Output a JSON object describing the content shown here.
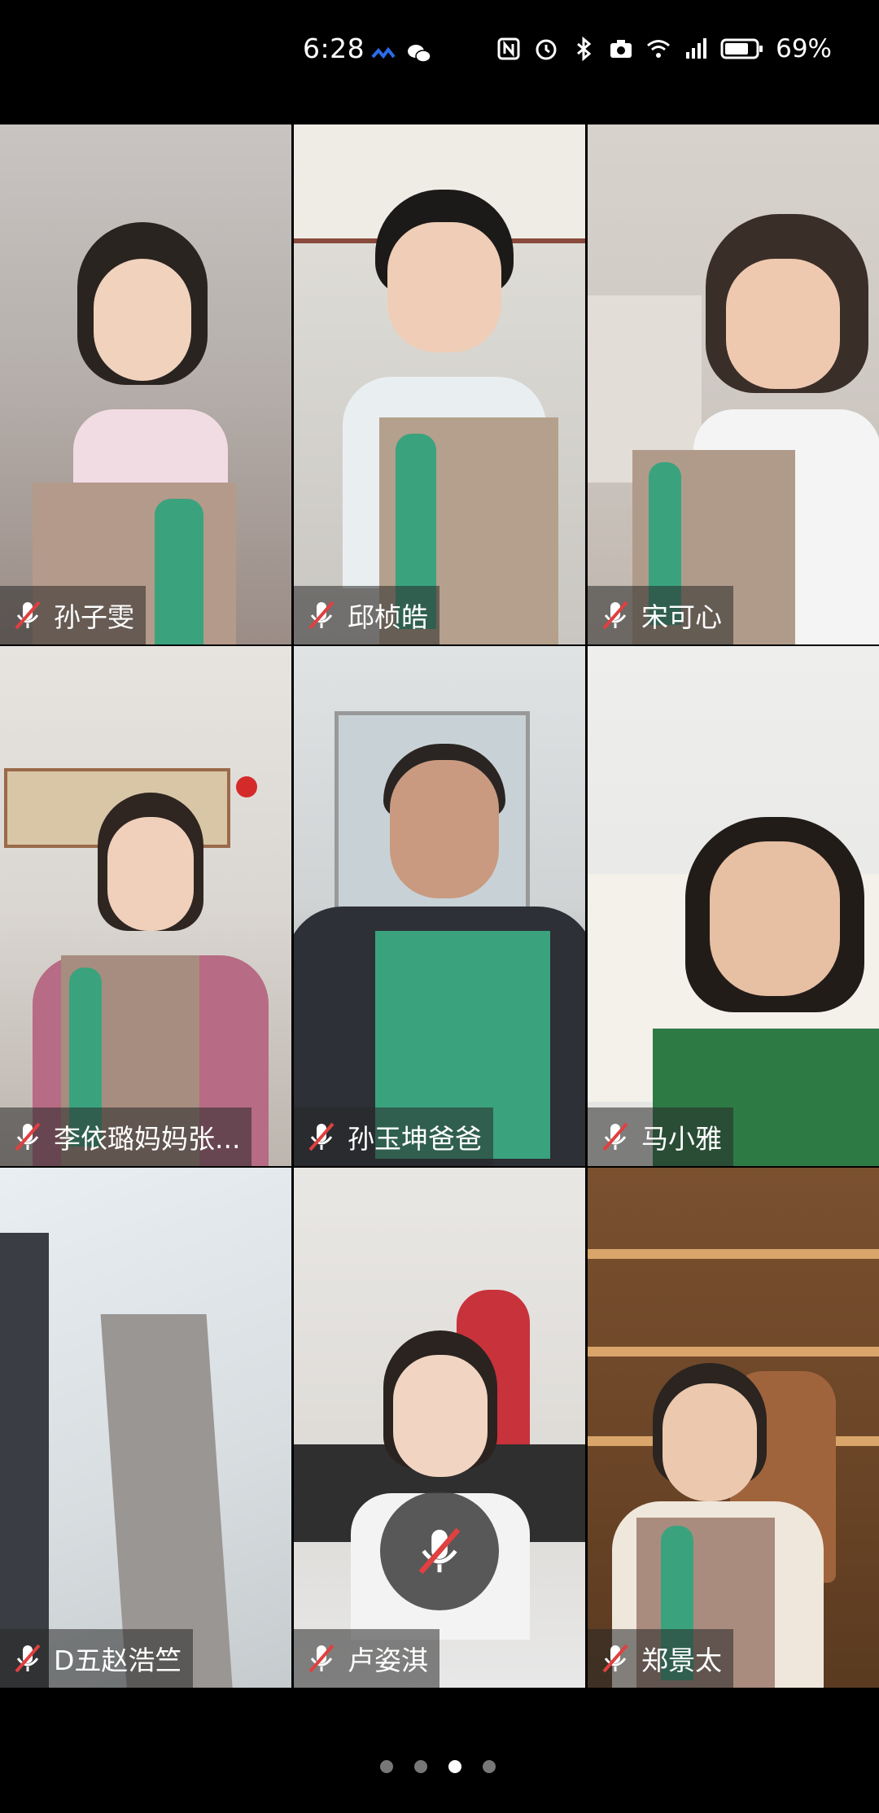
{
  "status_bar": {
    "time": "6:28",
    "battery": "69%",
    "network": "4G",
    "icons": [
      "app-notification-icon",
      "wechat-icon",
      "nfc-icon",
      "alarm-icon",
      "bluetooth-icon",
      "camera-icon",
      "wifi-icon",
      "signal-icon",
      "battery-icon"
    ]
  },
  "participants": [
    {
      "name": "孙子雯",
      "muted": true
    },
    {
      "name": "邱桢皓",
      "muted": true
    },
    {
      "name": "宋可心",
      "muted": true
    },
    {
      "name": "李依璐妈妈张...",
      "muted": true
    },
    {
      "name": "孙玉坤爸爸",
      "muted": true
    },
    {
      "name": "马小雅",
      "muted": true
    },
    {
      "name": "D五赵浩竺",
      "muted": true
    },
    {
      "name": "卢姿淇",
      "muted": true
    },
    {
      "name": "郑景太",
      "muted": true
    }
  ],
  "controls": {
    "mic_muted": true
  },
  "pagination": {
    "total": 4,
    "current": 3
  },
  "colors": {
    "book_green": "#3aa37e",
    "chip_bg": "#282828",
    "mute_red": "#e04040"
  }
}
